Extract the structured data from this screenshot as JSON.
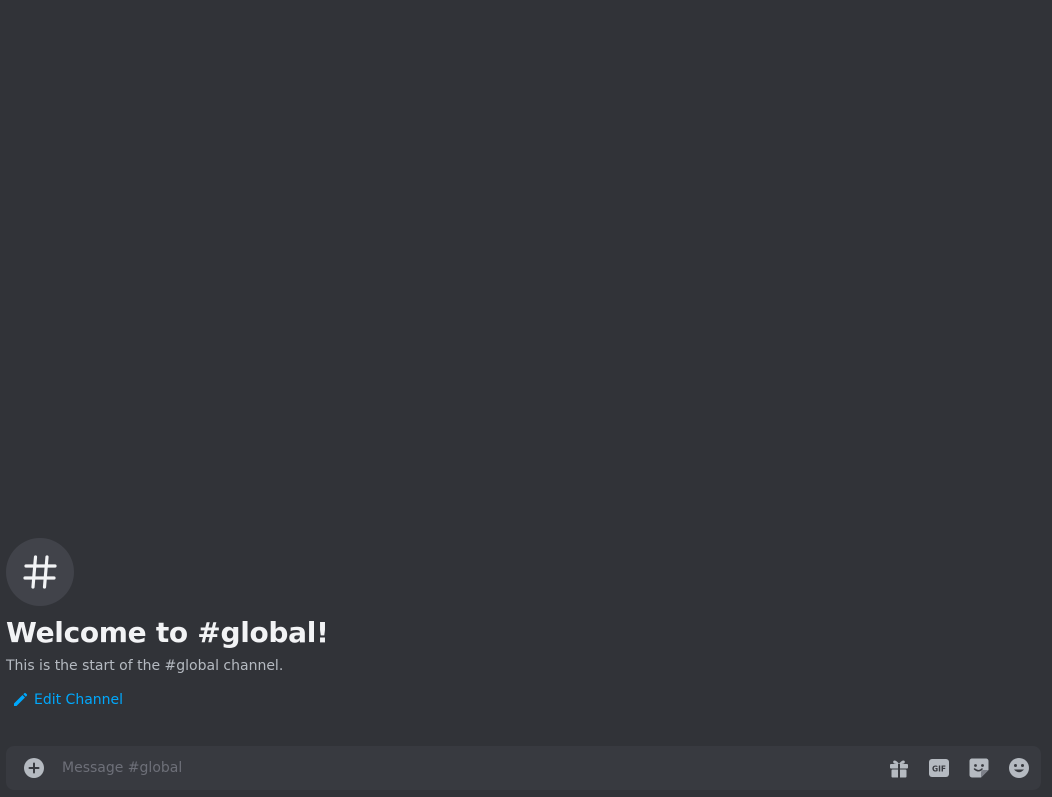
{
  "channel": {
    "name": "global",
    "icon": "hash-icon"
  },
  "welcome": {
    "title": "Welcome to #global!",
    "subtitle": "This is the start of the #global channel.",
    "edit_label": "Edit Channel",
    "edit_icon": "pencil-icon"
  },
  "composer": {
    "placeholder": "Message #global",
    "value": "",
    "attach_icon": "plus-circle-icon",
    "gift_icon": "gift-icon",
    "gif_label": "GIF",
    "sticker_icon": "sticker-icon",
    "emoji_icon": "emoji-icon"
  },
  "colors": {
    "background": "#313338",
    "composer_bg": "#383a40",
    "link": "#00a8fc",
    "heading": "#f2f3f5",
    "muted": "#b5bac1"
  }
}
